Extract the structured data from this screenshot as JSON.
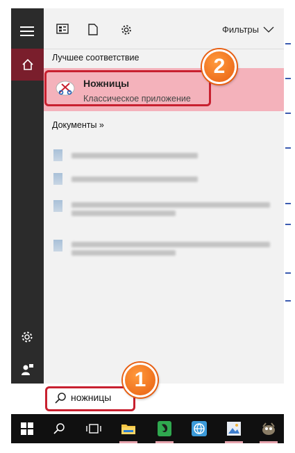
{
  "toolbar": {
    "filters_label": "Фильтры"
  },
  "best_match": {
    "section_label": "Лучшее соответствие",
    "app_name": "Ножницы",
    "app_type": "Классическое приложение"
  },
  "documents": {
    "section_label": "Документы",
    "chevron": "»"
  },
  "search": {
    "value": "ножницы"
  },
  "badges": {
    "search_step": "1",
    "result_step": "2"
  },
  "colors": {
    "accent": "#7a1e2c",
    "highlight": "#f4b2bb",
    "marker": "#c8202f",
    "badge": "#e85f12"
  }
}
